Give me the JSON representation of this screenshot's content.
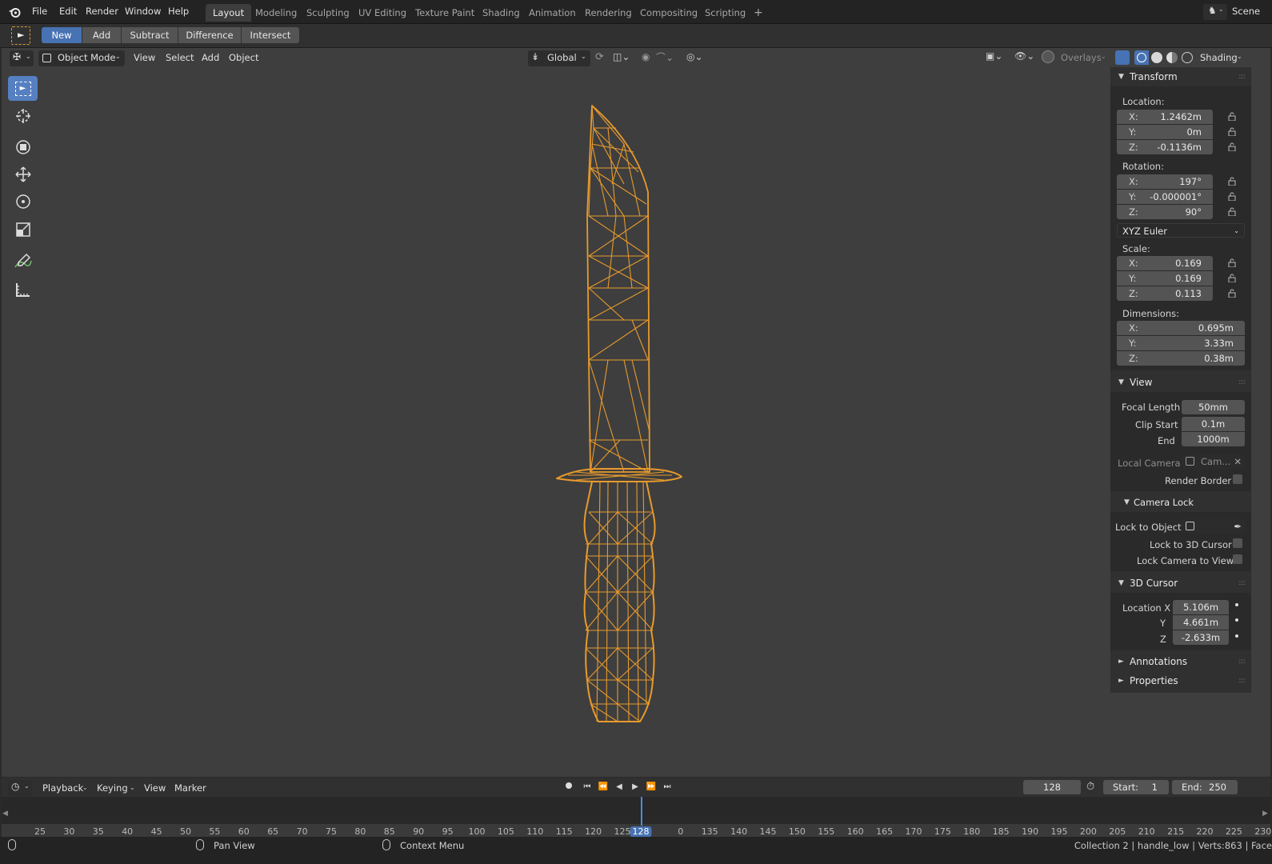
{
  "menu": {
    "items": [
      "File",
      "Edit",
      "Render",
      "Window",
      "Help"
    ]
  },
  "workspaces": {
    "tabs": [
      "Layout",
      "Modeling",
      "Sculpting",
      "UV Editing",
      "Texture Paint",
      "Shading",
      "Animation",
      "Rendering",
      "Compositing",
      "Scripting"
    ],
    "active": "Layout",
    "add": "+"
  },
  "scene": {
    "label": "Scene"
  },
  "boolean_tools": {
    "buttons": [
      "New",
      "Add",
      "Subtract",
      "Difference",
      "Intersect"
    ],
    "selected": "New"
  },
  "viewport_header": {
    "mode": "Object Mode",
    "menus": [
      "View",
      "Select",
      "Add",
      "Object"
    ],
    "orientation": "Global",
    "overlays": "Overlays",
    "shading": "Shading"
  },
  "toolbar": {
    "tools": [
      "select-box-tool",
      "cursor-tool",
      "transform-tool",
      "move-tool",
      "rotate-tool",
      "scale-tool",
      "annotate-tool",
      "measure-tool"
    ],
    "active": "select-box-tool"
  },
  "transform": {
    "title": "Transform",
    "location_label": "Location:",
    "location": [
      {
        "axis": "X:",
        "value": "1.2462m"
      },
      {
        "axis": "Y:",
        "value": "0m"
      },
      {
        "axis": "Z:",
        "value": "-0.1136m"
      }
    ],
    "rotation_label": "Rotation:",
    "rotation": [
      {
        "axis": "X:",
        "value": "197°"
      },
      {
        "axis": "Y:",
        "value": "-0.000001°"
      },
      {
        "axis": "Z:",
        "value": "90°"
      }
    ],
    "rotation_mode": "XYZ Euler",
    "scale_label": "Scale:",
    "scale": [
      {
        "axis": "X:",
        "value": "0.169"
      },
      {
        "axis": "Y:",
        "value": "0.169"
      },
      {
        "axis": "Z:",
        "value": "0.113"
      }
    ],
    "dimensions_label": "Dimensions:",
    "dimensions": [
      {
        "axis": "X:",
        "value": "0.695m"
      },
      {
        "axis": "Y:",
        "value": "3.33m"
      },
      {
        "axis": "Z:",
        "value": "0.38m"
      }
    ]
  },
  "view": {
    "title": "View",
    "focal_label": "Focal Length",
    "focal": "50mm",
    "clip_start_label": "Clip Start",
    "clip_start": "0.1m",
    "end_label": "End",
    "end": "1000m",
    "local_camera_label": "Local Camera",
    "local_camera": "Cam...",
    "render_border_label": "Render Border"
  },
  "camera_lock": {
    "title": "Camera Lock",
    "lock_object_label": "Lock to Object",
    "lock_cursor_label": "Lock to 3D Cursor",
    "lock_view_label": "Lock Camera to View"
  },
  "cursor3d": {
    "title": "3D Cursor",
    "loc_x_label": "Location X",
    "y_label": "Y",
    "z_label": "Z",
    "x": "5.106m",
    "y": "4.661m",
    "z": "-2.633m"
  },
  "collapsed_panels": [
    "Annotations",
    "Properties"
  ],
  "timeline": {
    "menus": [
      "Playback",
      "Keying",
      "View",
      "Marker"
    ],
    "current_frame": "128",
    "start_label": "Start:",
    "start": "1",
    "end_label": "End:",
    "end": "250",
    "ticks": [
      "25",
      "30",
      "35",
      "40",
      "45",
      "50",
      "55",
      "60",
      "65",
      "70",
      "75",
      "80",
      "85",
      "90",
      "95",
      "100",
      "105",
      "110",
      "115",
      "120",
      "125",
      "128",
      "0",
      "135",
      "140",
      "145",
      "150",
      "155",
      "160",
      "165",
      "170",
      "175",
      "180",
      "185",
      "190",
      "195",
      "200",
      "205",
      "210",
      "215",
      "220",
      "225",
      "230"
    ]
  },
  "status": {
    "pan": "Pan View",
    "context": "Context Menu",
    "info": "Collection 2 | handle_low | Verts:863 | Face"
  },
  "colors": {
    "accent": "#4772b3",
    "wire": "#e89a2c",
    "active_tool": "#5680c2"
  }
}
